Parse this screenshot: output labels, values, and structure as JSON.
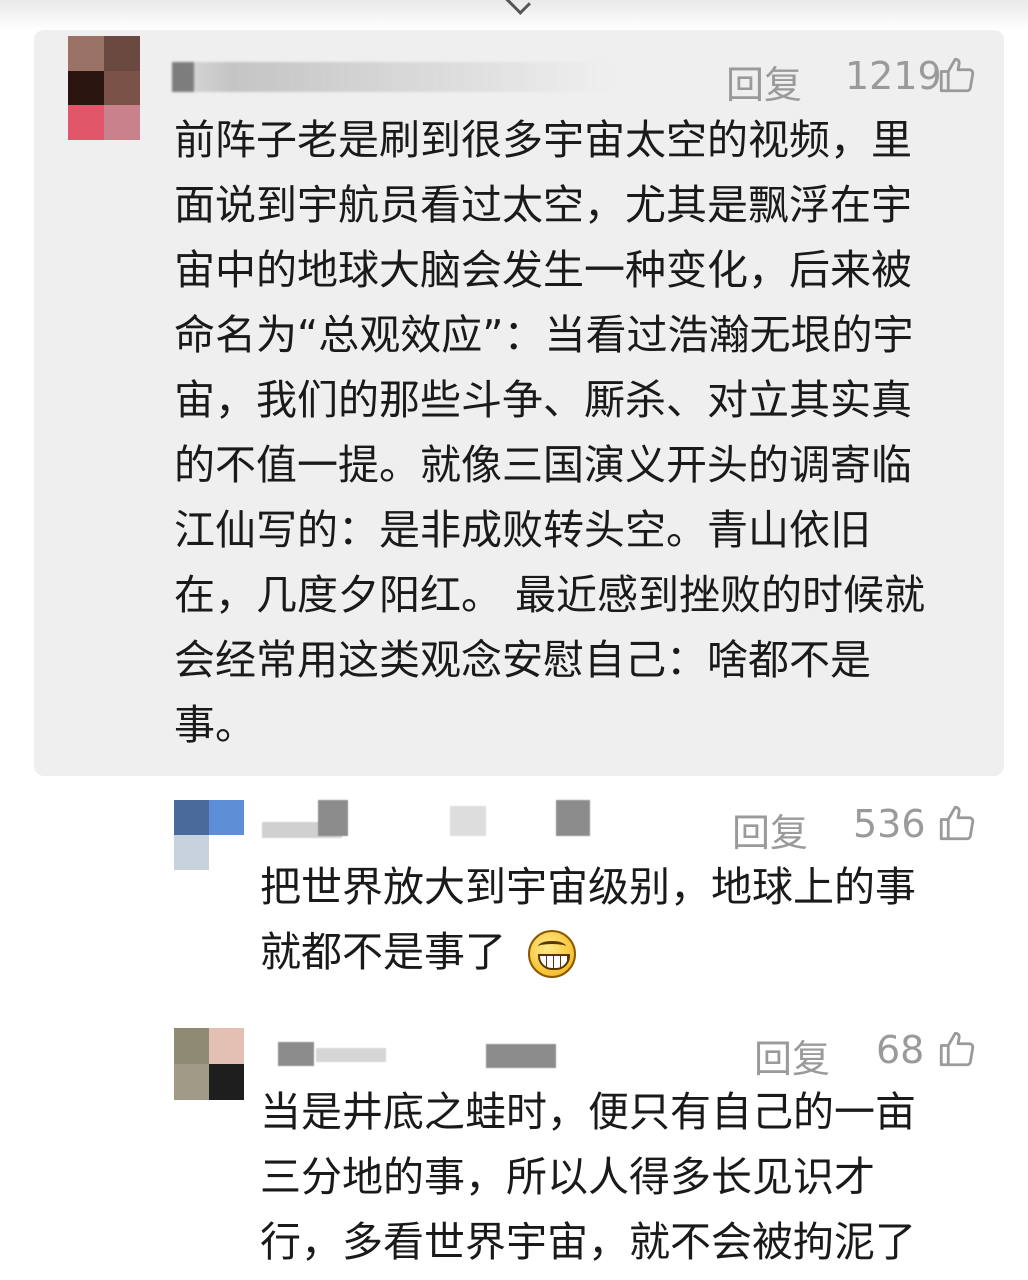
{
  "comments": [
    {
      "reply_label": "回复",
      "likes": "1219",
      "body": "前阵子老是刷到很多宇宙太空的视频，里\n面说到宇航员看过太空，尤其是飘浮在宇\n宙中的地球大脑会发生一种变化，后来被\n命名为“总观效应”：当看过浩瀚无垠的宇\n宙，我们的那些斗争、厮杀、对立其实真\n的不值一提。就像三国演义开头的调寄临\n江仙写的：是非成败转头空。青山依旧\n在，几度夕阳红。 最近感到挫败的时候就\n会经常用这类观念安慰自己：啥都不是\n事。"
    },
    {
      "reply_label": "回复",
      "likes": "536",
      "body": "把世界放大到宇宙级别，地球上的事\n就都不是事了",
      "emoji": "grinning-face-emoji"
    },
    {
      "reply_label": "回复",
      "likes": "68",
      "body": "当是井底之蛙时，便只有自己的一亩\n三分地的事，所以人得多长见识才\n行，多看世界宇宙，就不会被拘泥了"
    }
  ],
  "icons": {
    "like": "thumbs-up-icon",
    "collapse": "chevron-down-icon"
  },
  "colors": {
    "highlight_bg": "#efefef",
    "meta_text": "#9a9a9a",
    "body_text": "#1a1a1a"
  }
}
